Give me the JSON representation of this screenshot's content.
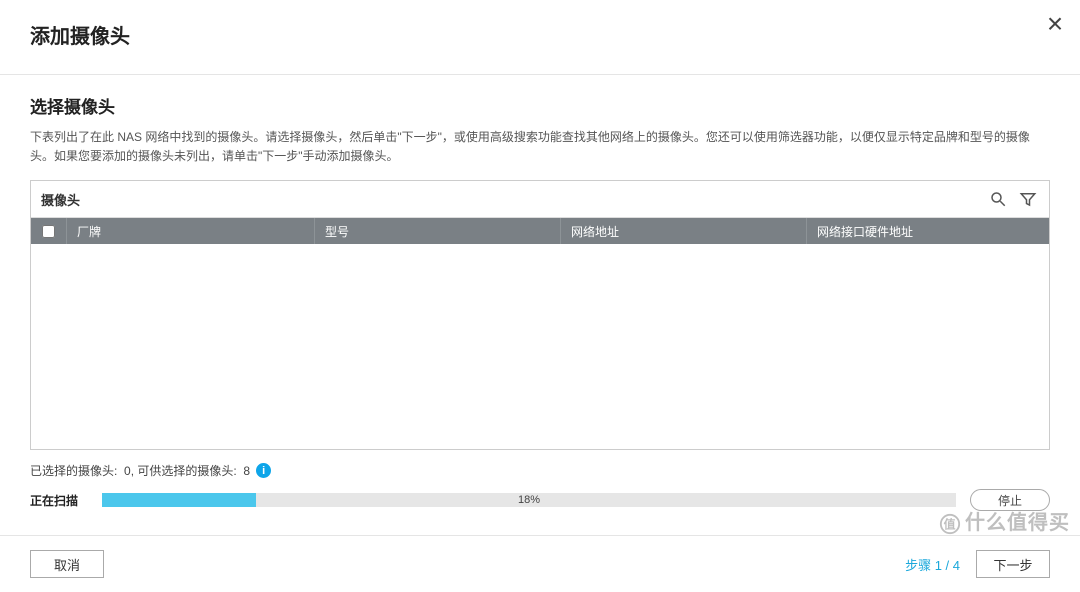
{
  "dialog": {
    "title": "添加摄像头",
    "subtitle": "选择摄像头",
    "description": "下表列出了在此 NAS 网络中找到的摄像头。请选择摄像头，然后单击\"下一步\"，或使用高级搜索功能查找其他网络上的摄像头。您还可以使用筛选器功能，以便仅显示特定品牌和型号的摄像头。如果您要添加的摄像头未列出，请单击\"下一步\"手动添加摄像头。"
  },
  "table": {
    "caption": "摄像头",
    "columns": {
      "brand": "厂牌",
      "model": "型号",
      "netaddr": "网络地址",
      "macaddr": "网络接口硬件地址"
    }
  },
  "status": {
    "selected_label": "已选择的摄像头:",
    "selected_count": "0",
    "separator": ",",
    "available_label": "可供选择的摄像头:",
    "available_count": "8"
  },
  "scan": {
    "label": "正在扫描",
    "percent_text": "18%",
    "percent_value": 18,
    "stop": "停止"
  },
  "footer": {
    "cancel": "取消",
    "step": "步骤 1 / 4",
    "next": "下一步"
  },
  "watermark": "什么值得买"
}
